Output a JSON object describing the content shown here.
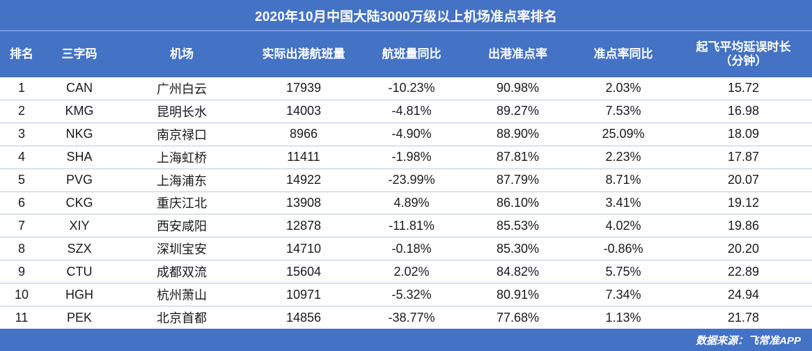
{
  "title": "2020年10月中国大陆3000万级以上机场准点率排名",
  "footer": {
    "source_label": "数据来源：飞常准APP"
  },
  "colors": {
    "accent_blue": "#4472C4",
    "header_divider": "#7B9BDC",
    "row_border": "#B9C8DE",
    "row_bg": "#FFFFFF",
    "text": "#1A1A1A"
  },
  "chart_data": {
    "type": "table",
    "title": "2020年10月中国大陆3000万级以上机场准点率排名",
    "columns": [
      {
        "key": "rank",
        "label": "排名",
        "sub": ""
      },
      {
        "key": "iata",
        "label": "三字码",
        "sub": ""
      },
      {
        "key": "airport",
        "label": "机场",
        "sub": ""
      },
      {
        "key": "flights",
        "label": "实际出港航班量",
        "sub": ""
      },
      {
        "key": "flt_yoy",
        "label": "航班量同比",
        "sub": ""
      },
      {
        "key": "otp",
        "label": "出港准点率",
        "sub": ""
      },
      {
        "key": "otp_yoy",
        "label": "准点率同比",
        "sub": ""
      },
      {
        "key": "delay",
        "label": "起飞平均延误时长",
        "sub": "（分钟）"
      }
    ],
    "rows": [
      {
        "rank": "1",
        "iata": "CAN",
        "airport": "广州白云",
        "flights": "17939",
        "flt_yoy": "-10.23%",
        "otp": "90.98%",
        "otp_yoy": "2.03%",
        "delay": "15.72"
      },
      {
        "rank": "2",
        "iata": "KMG",
        "airport": "昆明长水",
        "flights": "14003",
        "flt_yoy": "-4.81%",
        "otp": "89.27%",
        "otp_yoy": "7.53%",
        "delay": "16.98"
      },
      {
        "rank": "3",
        "iata": "NKG",
        "airport": "南京禄口",
        "flights": "8966",
        "flt_yoy": "-4.90%",
        "otp": "88.90%",
        "otp_yoy": "25.09%",
        "delay": "18.09"
      },
      {
        "rank": "4",
        "iata": "SHA",
        "airport": "上海虹桥",
        "flights": "11411",
        "flt_yoy": "-1.98%",
        "otp": "87.81%",
        "otp_yoy": "2.23%",
        "delay": "17.87"
      },
      {
        "rank": "5",
        "iata": "PVG",
        "airport": "上海浦东",
        "flights": "14922",
        "flt_yoy": "-23.99%",
        "otp": "87.79%",
        "otp_yoy": "8.71%",
        "delay": "20.07"
      },
      {
        "rank": "6",
        "iata": "CKG",
        "airport": "重庆江北",
        "flights": "13908",
        "flt_yoy": "4.89%",
        "otp": "86.10%",
        "otp_yoy": "3.41%",
        "delay": "19.12"
      },
      {
        "rank": "7",
        "iata": "XIY",
        "airport": "西安咸阳",
        "flights": "12878",
        "flt_yoy": "-11.81%",
        "otp": "85.53%",
        "otp_yoy": "4.02%",
        "delay": "19.86"
      },
      {
        "rank": "8",
        "iata": "SZX",
        "airport": "深圳宝安",
        "flights": "14710",
        "flt_yoy": "-0.18%",
        "otp": "85.30%",
        "otp_yoy": "-0.86%",
        "delay": "20.20"
      },
      {
        "rank": "9",
        "iata": "CTU",
        "airport": "成都双流",
        "flights": "15604",
        "flt_yoy": "2.02%",
        "otp": "84.82%",
        "otp_yoy": "5.75%",
        "delay": "22.89"
      },
      {
        "rank": "10",
        "iata": "HGH",
        "airport": "杭州萧山",
        "flights": "10971",
        "flt_yoy": "-5.32%",
        "otp": "80.91%",
        "otp_yoy": "7.34%",
        "delay": "24.94"
      },
      {
        "rank": "11",
        "iata": "PEK",
        "airport": "北京首都",
        "flights": "14856",
        "flt_yoy": "-38.77%",
        "otp": "77.68%",
        "otp_yoy": "1.13%",
        "delay": "21.78"
      }
    ]
  }
}
